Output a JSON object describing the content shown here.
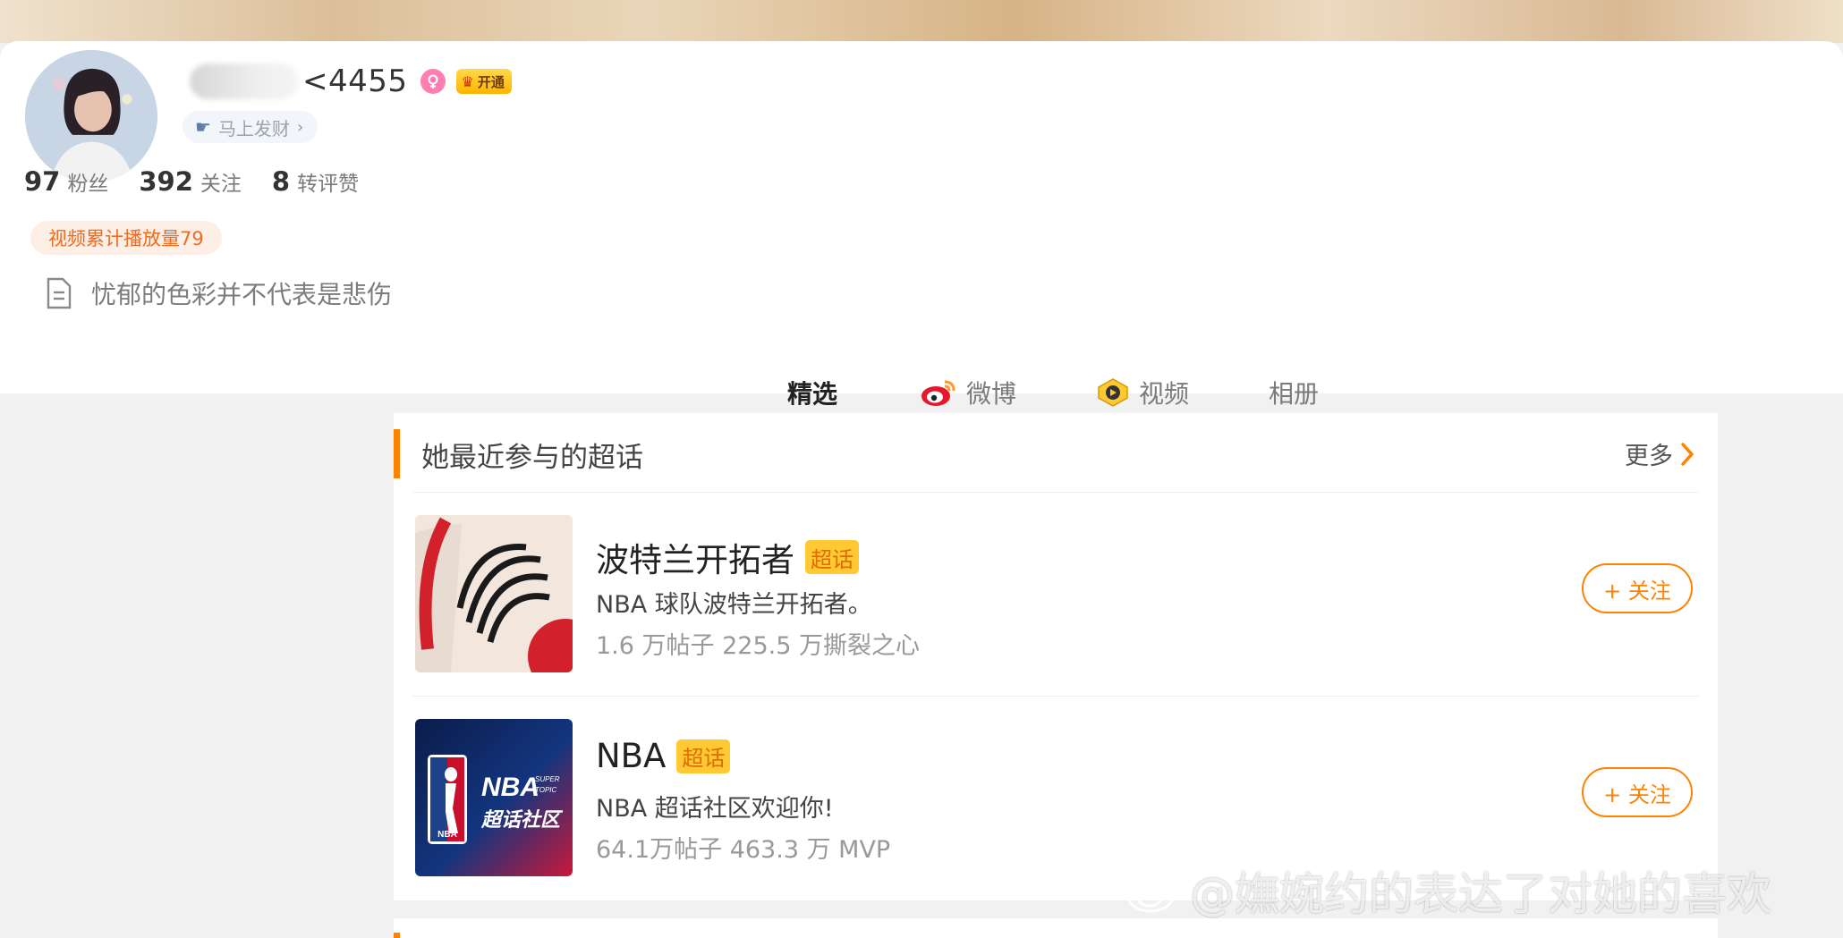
{
  "profile": {
    "name_visible": "<4455",
    "vip_label": "开通",
    "rich_tag": "马上发财",
    "stats": [
      {
        "num": "97",
        "label": "粉丝"
      },
      {
        "num": "392",
        "label": "关注"
      },
      {
        "num": "8",
        "label": "转评赞"
      }
    ],
    "video_tag": "视频累计播放量79",
    "bio": "忧郁的色彩并不代表是悲伤"
  },
  "tabs": [
    {
      "label": "精选",
      "active": true
    },
    {
      "label": "微博",
      "icon": "weibo-icon"
    },
    {
      "label": "视频",
      "icon": "video-icon"
    },
    {
      "label": "相册"
    }
  ],
  "card": {
    "title": "她最近参与的超话",
    "more": "更多",
    "topics": [
      {
        "name": "波特兰开拓者",
        "badge": "超话",
        "desc": "NBA 球队波特兰开拓者。",
        "stats": "1.6 万帖子  225.5 万撕裂之心",
        "follow": "+ 关注",
        "thumb": "trail-blazers-logo"
      },
      {
        "name": "NBA",
        "badge": "超话",
        "desc": "NBA 超话社区欢迎你!",
        "stats": "64.1万帖子  463.3 万 MVP",
        "follow": "+ 关注",
        "thumb": "nba-super-topic"
      }
    ]
  },
  "nba_thumb": {
    "big": "NBA",
    "sub1": "SUPER",
    "sub2": "TOPIC",
    "cn": "超话社区",
    "small": "NBA"
  },
  "watermark": "@嫵婉约的表达了对她的喜欢",
  "colors": {
    "accent": "#ff8200",
    "badge_bg": "#ffc933",
    "tag_bg": "#fdefe6"
  }
}
